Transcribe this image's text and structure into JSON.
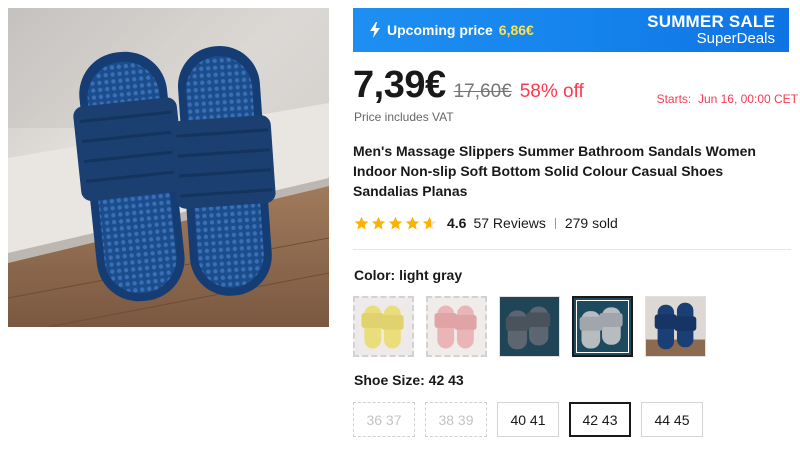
{
  "banner": {
    "upcoming_label": "Upcoming price",
    "upcoming_price": "6,86€",
    "sale_title": "SUMMER SALE",
    "sale_subtitle": "SuperDeals",
    "colors": {
      "start": "#1e8ff2",
      "end": "#0f73e3",
      "highlight": "#ffe14d"
    },
    "icon": "lightning-icon"
  },
  "price": {
    "current": "7,39€",
    "original": "17,60€",
    "discount": "58% off",
    "starts": "Starts:  Jun 16, 00:00 CET",
    "vat_note": "Price includes VAT",
    "accent_color": "#fd384f"
  },
  "product": {
    "title": "Men's Massage Slippers Summer Bathroom Sandals Women Indoor Non-slip Soft Bottom Solid Colour Casual Shoes Sandalias Planas",
    "image_icon": "product-photo-navy-slippers"
  },
  "rating": {
    "stars": 4.6,
    "stars_max": 5,
    "value": "4.6",
    "reviews": "57 Reviews",
    "sold": "279 sold",
    "star_color": "#fdb100"
  },
  "color": {
    "label": "Color: light gray",
    "options": [
      {
        "name": "yellow",
        "state": "unavailable"
      },
      {
        "name": "pink",
        "state": "unavailable"
      },
      {
        "name": "dark gray",
        "state": "available"
      },
      {
        "name": "light gray",
        "state": "selected"
      },
      {
        "name": "navy blue",
        "state": "available"
      }
    ]
  },
  "size": {
    "label": "Shoe Size: 42 43",
    "options": [
      {
        "label": "36 37",
        "state": "unavailable"
      },
      {
        "label": "38 39",
        "state": "unavailable"
      },
      {
        "label": "40 41",
        "state": "available"
      },
      {
        "label": "42 43",
        "state": "selected"
      },
      {
        "label": "44 45",
        "state": "available"
      }
    ]
  }
}
